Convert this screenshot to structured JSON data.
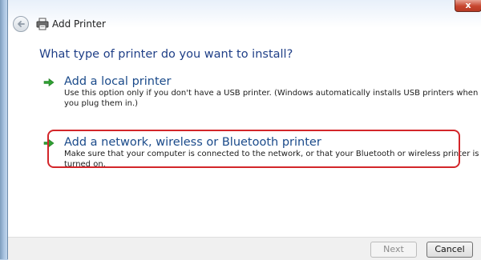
{
  "window": {
    "title": "Add Printer",
    "close_label": "x"
  },
  "heading": "What type of printer do you want to install?",
  "options": [
    {
      "title": "Add a local printer",
      "description": "Use this option only if you don't have a USB printer. (Windows automatically installs USB printers when you plug them in.)",
      "icon": "green-arrow-icon"
    },
    {
      "title": "Add a network, wireless or Bluetooth printer",
      "description": "Make sure that your computer is connected to the network, or that your Bluetooth or wireless printer is turned on.",
      "icon": "green-arrow-icon",
      "highlighted": true
    }
  ],
  "buttons": {
    "next": "Next",
    "cancel": "Cancel"
  },
  "colors": {
    "heading": "#1f3f87",
    "highlight": "#d3262a",
    "arrow": "#2fa032"
  }
}
